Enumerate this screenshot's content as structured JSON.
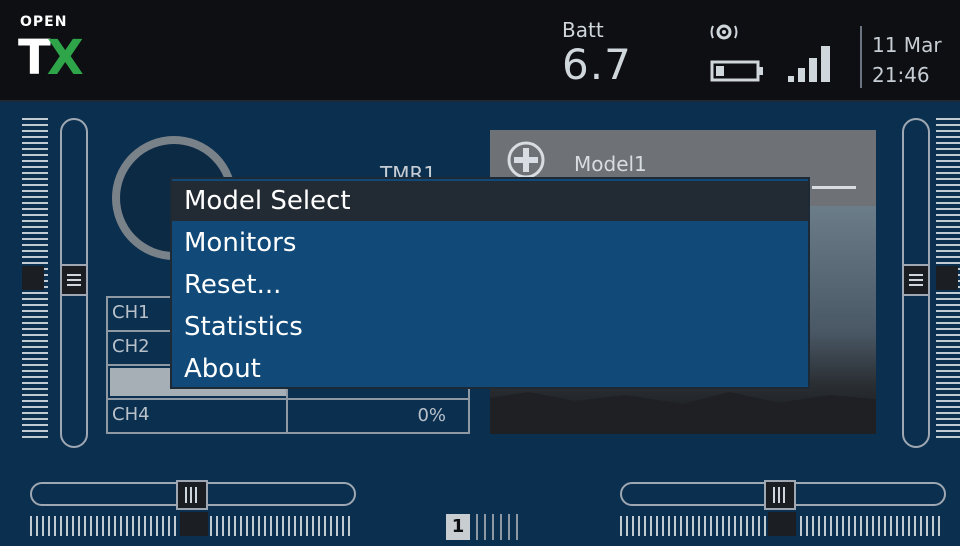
{
  "topbar": {
    "logo_open": "OPEN",
    "logo_t": "T",
    "logo_x": "X",
    "batt_label": "Batt",
    "batt_value": "6.7",
    "date": "11 Mar",
    "time": "21:46"
  },
  "timer": {
    "name": "TMR1"
  },
  "model": {
    "name": "Model1"
  },
  "channels": [
    {
      "name": "CH1",
      "value": ""
    },
    {
      "name": "CH2",
      "value": ""
    },
    {
      "name": "",
      "value": ""
    },
    {
      "name": "CH4",
      "value": "0%"
    }
  ],
  "menu": {
    "items": [
      "Model Select",
      "Monitors",
      "Reset...",
      "Statistics",
      "About"
    ],
    "selected_index": 0
  },
  "bottom": {
    "flight_mode": "1"
  },
  "colors": {
    "background": "#0b2f4f",
    "topbar": "#0d0f12",
    "menu": "#114a78",
    "menu_selected": "#222a33",
    "logo_x": "#2fa54a"
  }
}
